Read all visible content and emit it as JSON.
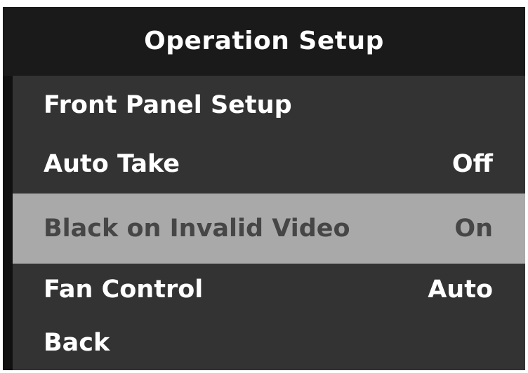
{
  "header": {
    "title": "Operation Setup"
  },
  "menu": {
    "items": [
      {
        "label": "Front Panel Setup",
        "value": ""
      },
      {
        "label": "Auto Take",
        "value": "Off"
      },
      {
        "label": "Black on Invalid Video",
        "value": "On",
        "selected": true
      },
      {
        "label": "Fan Control",
        "value": "Auto"
      },
      {
        "label": "Back",
        "value": ""
      }
    ]
  },
  "colors": {
    "header_bg": "#1a1a1a",
    "menu_bg": "#333333",
    "selected_bg": "#a9a9a9",
    "selected_text": "#464646",
    "text": "#ffffff"
  }
}
